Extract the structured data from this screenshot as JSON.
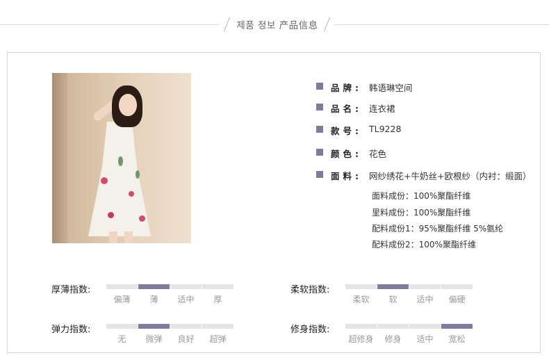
{
  "header": {
    "title": "제품 정보 产品信息"
  },
  "photo": {
    "description_icon": "model-photo"
  },
  "specs": [
    {
      "label": "品牌:",
      "value": "韩语琳空间"
    },
    {
      "label": "品名:",
      "value": "连衣裙"
    },
    {
      "label": "款号:",
      "value": "TL9228"
    },
    {
      "label": "颜色:",
      "value": "花色"
    },
    {
      "label": "面料:",
      "value": "网纱绣花+牛奶丝+欧根纱（内衬：缎面）"
    }
  ],
  "composition": [
    "面料成份：100%聚酯纤维",
    "里料成份：100%聚酯纤维",
    "配料成份1：95%聚酯纤维 5%氨纶",
    "配料成份2：100%聚酯纤维"
  ],
  "scales": [
    {
      "label": "厚薄指数:",
      "options": [
        "偏薄",
        "薄",
        "适中",
        "厚"
      ],
      "selected": 1
    },
    {
      "label": "柔软指数:",
      "options": [
        "柔软",
        "软",
        "适中",
        "偏硬"
      ],
      "selected": 1
    },
    {
      "label": "弹力指数:",
      "options": [
        "无",
        "微弹",
        "良好",
        "超弹"
      ],
      "selected": 1
    },
    {
      "label": "修身指数:",
      "options": [
        "超修身",
        "修身",
        "适中",
        "宽松"
      ],
      "selected": 3
    }
  ],
  "colors": {
    "accent": "#807a9c",
    "inactive": "#e4e4e4"
  }
}
